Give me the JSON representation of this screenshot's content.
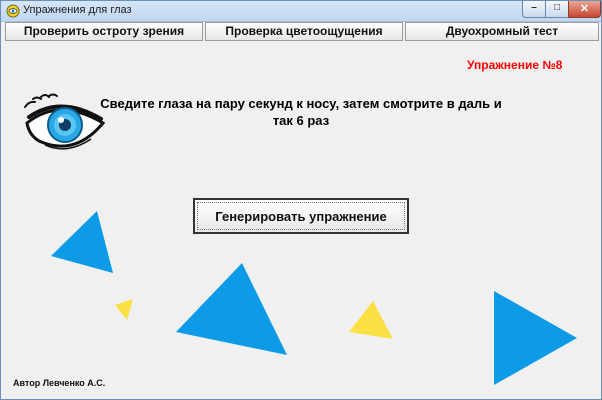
{
  "window": {
    "title": "Упражнения для глаз",
    "minimize_glyph": "–",
    "maximize_glyph": "□",
    "close_glyph": "✕"
  },
  "tabs": [
    {
      "label": "Проверить остроту зрения"
    },
    {
      "label": "Проверка цветоощущения"
    },
    {
      "label": "Двуохромный тест"
    }
  ],
  "exercise": {
    "number_label": "Упражнение №8",
    "instruction": "Сведите глаза на пару секунд к носу, затем смотрите в даль и так 6 раз"
  },
  "generate_button": {
    "label": "Генерировать упражнение"
  },
  "author": "Автор Левченко А.С.",
  "colors": {
    "blue_triangle": "#0d9be8",
    "yellow_triangle": "#fbe045",
    "exercise_number": "#ff0000"
  },
  "icons": {
    "eye": "eye-icon",
    "app": "app-icon"
  }
}
